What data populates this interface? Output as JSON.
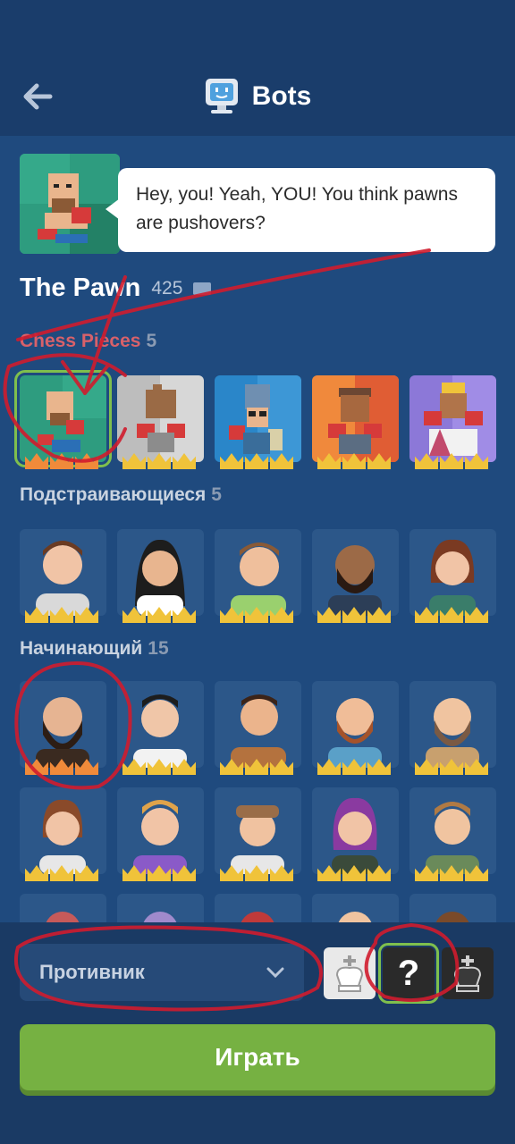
{
  "header": {
    "title": "Bots",
    "back_icon": "arrow-left-icon",
    "title_icon": "robot-monitor-icon"
  },
  "bot": {
    "name": "The Pawn",
    "rating": "425",
    "speech": "Hey, you! Yeah, YOU! You think pawns are pushovers?"
  },
  "sections": [
    {
      "title": "Chess Pieces",
      "count": "5"
    },
    {
      "title": "Подстраивающиеся",
      "count": "5"
    },
    {
      "title": "Начинающий",
      "count": "15"
    }
  ],
  "chess_pieces": [
    {
      "bg": "#2e9c7f",
      "crown_color": "#f08a3a",
      "selected": true
    },
    {
      "bg": "#d7d7d7",
      "crown_color": "#f0c33a",
      "selected": false
    },
    {
      "bg": "#2a86c9",
      "crown_color": "#f0c33a",
      "selected": false
    },
    {
      "bg": "#f0893c",
      "crown_color": "#f0c33a",
      "selected": false
    },
    {
      "bg": "#8c78d8",
      "crown_color": "#f0c33a",
      "selected": false
    }
  ],
  "colors": {
    "accent_green": "#76b142",
    "crown_gold": "#f0c33a",
    "annotation_red": "#d01c2e"
  },
  "bottom": {
    "opponent_label": "Противник",
    "play_label": "Играть"
  }
}
